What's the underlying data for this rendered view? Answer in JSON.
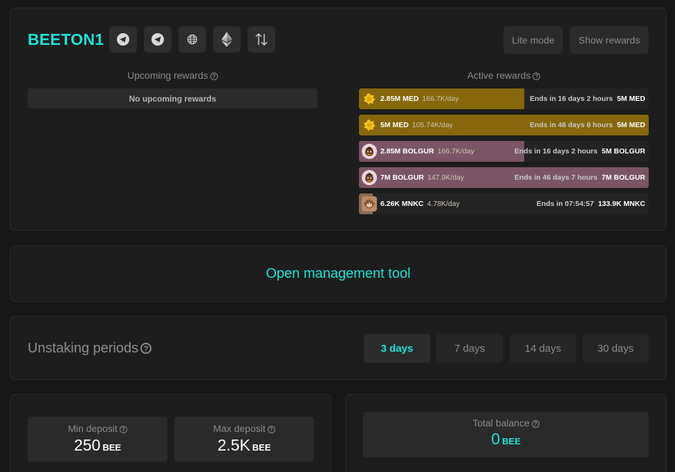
{
  "project": {
    "title": "BEETON1"
  },
  "header_icons": [
    "telegram-icon",
    "telegram-icon",
    "globe-icon",
    "ethereum-icon",
    "swap-arrows-icon"
  ],
  "header_buttons": {
    "lite_mode": "Lite mode",
    "show_rewards": "Show rewards"
  },
  "upcoming": {
    "heading": "Upcoming rewards",
    "empty": "No upcoming rewards"
  },
  "active": {
    "heading": "Active rewards",
    "rows": [
      {
        "amount": "2.85M MED",
        "rate": "166.7K/day",
        "ends": "Ends in 16 days 2 hours",
        "total": "5M MED",
        "progress": 0.57,
        "fill": "#86670c",
        "icon": "med-token-icon"
      },
      {
        "amount": "5M MED",
        "rate": "105.74K/day",
        "ends": "Ends in 46 days 6 hours",
        "total": "5M MED",
        "progress": 1.0,
        "fill": "#86670c",
        "icon": "med-token-icon"
      },
      {
        "amount": "2.85M BOLGUR",
        "rate": "166.7K/day",
        "ends": "Ends in 16 days 2 hours",
        "total": "5M BOLGUR",
        "progress": 0.57,
        "fill": "#7b5565",
        "icon": "bolgur-token-icon"
      },
      {
        "amount": "7M BOLGUR",
        "rate": "147.9K/day",
        "ends": "Ends in 46 days 7 hours",
        "total": "7M BOLGUR",
        "progress": 1.0,
        "fill": "#7b5565",
        "icon": "bolgur-token-icon"
      },
      {
        "amount": "6.26K MNKC",
        "rate": "4.78K/day",
        "ends": "Ends in 07:54:57",
        "total": "133.9K MNKC",
        "progress": 0.047,
        "fill": "#8a6b52",
        "icon": "mnkc-token-icon"
      }
    ]
  },
  "management": {
    "label": "Open management tool"
  },
  "unstaking": {
    "title": "Unstaking periods",
    "periods": [
      "3 days",
      "7 days",
      "14 days",
      "30 days"
    ],
    "selected": "3 days"
  },
  "deposit": {
    "min_label": "Min deposit",
    "min_value": "250",
    "min_unit": "BEE",
    "max_label": "Max deposit",
    "max_value": "2.5K",
    "max_unit": "BEE"
  },
  "balance": {
    "label": "Total balance",
    "value": "0",
    "unit": "BEE"
  },
  "colors": {
    "accent": "#1de2d6",
    "med": "#86670c",
    "bolgur": "#7b5565",
    "mnkc": "#8a6b52"
  }
}
